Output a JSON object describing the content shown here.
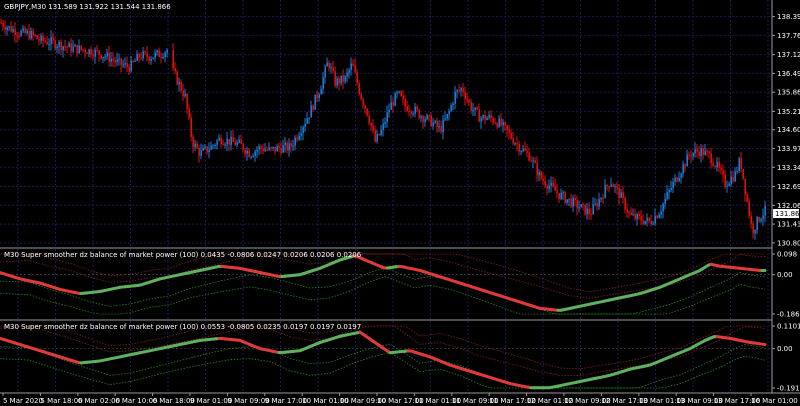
{
  "main": {
    "title": "GBPJPY,M30  131.589 131.922 131.544 131.866",
    "price_ticks": [
      "138.395",
      "137.765",
      "137.120",
      "136.490",
      "135.860",
      "135.215",
      "134.600",
      "133.970",
      "133.340",
      "132.695",
      "132.065",
      "131.435",
      "130.805"
    ],
    "current_price": "131.866"
  },
  "indicator1": {
    "title": "M30 Super smoother dz balance of market power (100) 0.0435 -0.0806 0.0247 0.0206 0.0206 0.0206",
    "ticks": [
      "0.098",
      "0.00",
      "-0.1867"
    ]
  },
  "indicator2": {
    "title": "M30 Super smoother dz balance of market power (100) 0.0553 -0.0805 0.0235 0.0197 0.0197 0.0197",
    "ticks": [
      "0.1101",
      "0.00",
      "-0.1915"
    ]
  },
  "time_axis": [
    "5 Mar 2020",
    "5 Mar 18:00",
    "6 Mar 02:00",
    "6 Mar 10:00",
    "6 Mar 18:00",
    "9 Mar 01:00",
    "9 Mar 09:00",
    "9 Mar 17:00",
    "10 Mar 01:00",
    "10 Mar 09:00",
    "10 Mar 17:00",
    "11 Mar 01:00",
    "11 Mar 09:00",
    "11 Mar 17:00",
    "12 Mar 01:00",
    "12 Mar 09:00",
    "12 Mar 17:00",
    "13 Mar 01:00",
    "13 Mar 09:00",
    "13 Mar 17:00",
    "16 Mar 01:00"
  ],
  "colors": {
    "background": "#000000",
    "grid": "#1a1a5a",
    "bull_candle": "#1e7bd6",
    "bear_candle": "#e01010",
    "line_up": "#5fb05f",
    "line_down": "#e03a3a",
    "band_green": "#1f8a1f",
    "band_red": "#8a1f1f",
    "separator": "#9a9a9a"
  },
  "chart_data": [
    {
      "type": "candlestick",
      "series": [
        {
          "name": "GBPJPY,M30",
          "close_path": [
            [
              0,
              138.2
            ],
            [
              10,
              138.0
            ],
            [
              20,
              137.85
            ],
            [
              30,
              137.8
            ],
            [
              40,
              137.6
            ],
            [
              50,
              137.55
            ],
            [
              60,
              137.45
            ],
            [
              70,
              137.35
            ],
            [
              80,
              137.3
            ],
            [
              90,
              137.25
            ],
            [
              100,
              137.15
            ],
            [
              110,
              137.0
            ],
            [
              120,
              136.8
            ],
            [
              130,
              136.7
            ],
            [
              140,
              137.1
            ],
            [
              150,
              137.05
            ],
            [
              160,
              137.15
            ],
            [
              168,
              137.3
            ],
            [
              172,
              136.6
            ],
            [
              178,
              136.2
            ],
            [
              185,
              135.7
            ],
            [
              192,
              134.2
            ],
            [
              200,
              133.8
            ],
            [
              210,
              134.0
            ],
            [
              220,
              134.3
            ],
            [
              230,
              134.2
            ],
            [
              240,
              134.1
            ],
            [
              250,
              133.8
            ],
            [
              260,
              134.0
            ],
            [
              270,
              133.9
            ],
            [
              280,
              134.0
            ],
            [
              290,
              134.0
            ],
            [
              300,
              134.6
            ],
            [
              310,
              135.2
            ],
            [
              320,
              136.0
            ],
            [
              328,
              136.9
            ],
            [
              335,
              136.2
            ],
            [
              345,
              136.3
            ],
            [
              352,
              136.8
            ],
            [
              360,
              135.8
            ],
            [
              368,
              135.1
            ],
            [
              375,
              134.2
            ],
            [
              382,
              134.6
            ],
            [
              390,
              135.4
            ],
            [
              398,
              135.8
            ],
            [
              405,
              135.4
            ],
            [
              412,
              135.3
            ],
            [
              420,
              135.1
            ],
            [
              430,
              134.9
            ],
            [
              440,
              134.6
            ],
            [
              448,
              135.1
            ],
            [
              455,
              135.8
            ],
            [
              462,
              136.0
            ],
            [
              470,
              135.4
            ],
            [
              480,
              135.0
            ],
            [
              490,
              135.0
            ],
            [
              500,
              134.8
            ],
            [
              510,
              134.4
            ],
            [
              520,
              134.0
            ],
            [
              530,
              133.7
            ],
            [
              540,
              133.0
            ],
            [
              550,
              132.7
            ],
            [
              560,
              132.4
            ],
            [
              570,
              132.2
            ],
            [
              580,
              132.0
            ],
            [
              590,
              131.8
            ],
            [
              600,
              132.3
            ],
            [
              610,
              132.9
            ],
            [
              620,
              132.4
            ],
            [
              630,
              131.7
            ],
            [
              640,
              131.6
            ],
            [
              650,
              131.5
            ],
            [
              660,
              131.9
            ],
            [
              670,
              132.6
            ],
            [
              680,
              133.2
            ],
            [
              690,
              133.8
            ],
            [
              700,
              133.9
            ],
            [
              710,
              133.7
            ],
            [
              718,
              133.3
            ],
            [
              725,
              132.8
            ],
            [
              735,
              133.1
            ],
            [
              740,
              133.6
            ],
            [
              745,
              132.6
            ],
            [
              752,
              131.2
            ],
            [
              760,
              131.7
            ],
            [
              765,
              131.87
            ]
          ]
        }
      ]
    },
    {
      "type": "line",
      "name": "indicator1",
      "ylim": [
        -0.1867,
        0.098
      ],
      "series": [
        {
          "name": "main",
          "points": [
            [
              0,
              0.01
            ],
            [
              20,
              -0.02
            ],
            [
              40,
              -0.04
            ],
            [
              60,
              -0.07
            ],
            [
              80,
              -0.09
            ],
            [
              100,
              -0.08
            ],
            [
              120,
              -0.06
            ],
            [
              140,
              -0.05
            ],
            [
              160,
              -0.02
            ],
            [
              180,
              0.0
            ],
            [
              200,
              0.02
            ],
            [
              220,
              0.04
            ],
            [
              240,
              0.03
            ],
            [
              260,
              0.01
            ],
            [
              280,
              -0.01
            ],
            [
              300,
              0.0
            ],
            [
              320,
              0.03
            ],
            [
              340,
              0.07
            ],
            [
              355,
              0.09
            ],
            [
              370,
              0.06
            ],
            [
              385,
              0.03
            ],
            [
              400,
              0.04
            ],
            [
              420,
              0.02
            ],
            [
              440,
              -0.01
            ],
            [
              460,
              -0.04
            ],
            [
              480,
              -0.07
            ],
            [
              500,
              -0.1
            ],
            [
              520,
              -0.13
            ],
            [
              540,
              -0.16
            ],
            [
              560,
              -0.17
            ],
            [
              580,
              -0.15
            ],
            [
              600,
              -0.13
            ],
            [
              620,
              -0.11
            ],
            [
              640,
              -0.09
            ],
            [
              660,
              -0.06
            ],
            [
              680,
              -0.02
            ],
            [
              700,
              0.02
            ],
            [
              710,
              0.05
            ],
            [
              720,
              0.04
            ],
            [
              740,
              0.03
            ],
            [
              760,
              0.02
            ],
            [
              765,
              0.02
            ]
          ]
        }
      ]
    },
    {
      "type": "line",
      "name": "indicator2",
      "ylim": [
        -0.1915,
        0.1101
      ],
      "series": [
        {
          "name": "main",
          "points": [
            [
              0,
              0.05
            ],
            [
              20,
              0.02
            ],
            [
              40,
              -0.01
            ],
            [
              60,
              -0.04
            ],
            [
              80,
              -0.07
            ],
            [
              100,
              -0.06
            ],
            [
              120,
              -0.04
            ],
            [
              140,
              -0.02
            ],
            [
              160,
              0.0
            ],
            [
              180,
              0.02
            ],
            [
              200,
              0.04
            ],
            [
              220,
              0.05
            ],
            [
              240,
              0.04
            ],
            [
              260,
              0.0
            ],
            [
              280,
              -0.02
            ],
            [
              300,
              -0.01
            ],
            [
              320,
              0.03
            ],
            [
              340,
              0.06
            ],
            [
              360,
              0.08
            ],
            [
              375,
              0.03
            ],
            [
              390,
              -0.02
            ],
            [
              410,
              -0.01
            ],
            [
              430,
              -0.04
            ],
            [
              450,
              -0.08
            ],
            [
              470,
              -0.11
            ],
            [
              490,
              -0.14
            ],
            [
              510,
              -0.17
            ],
            [
              530,
              -0.19
            ],
            [
              550,
              -0.19
            ],
            [
              570,
              -0.17
            ],
            [
              590,
              -0.15
            ],
            [
              610,
              -0.13
            ],
            [
              630,
              -0.1
            ],
            [
              650,
              -0.08
            ],
            [
              670,
              -0.04
            ],
            [
              690,
              0.0
            ],
            [
              705,
              0.04
            ],
            [
              715,
              0.06
            ],
            [
              730,
              0.05
            ],
            [
              750,
              0.03
            ],
            [
              765,
              0.02
            ]
          ]
        }
      ]
    }
  ]
}
